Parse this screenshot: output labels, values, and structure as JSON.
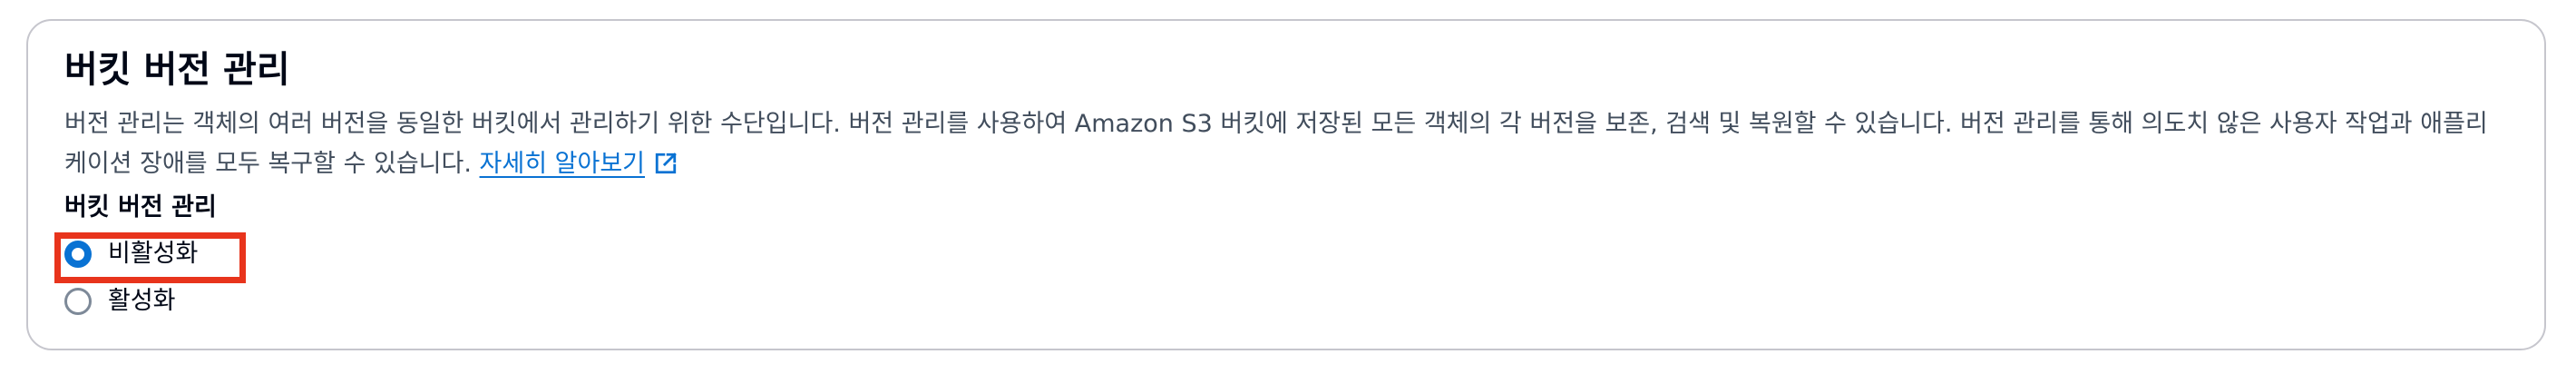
{
  "panel": {
    "title": "버킷 버전 관리",
    "description": "버전 관리는 객체의 여러 버전을 동일한 버킷에서 관리하기 위한 수단입니다. 버전 관리를 사용하여 Amazon S3 버킷에 저장된 모든 객체의 각 버전을 보존, 검색 및 복원할 수 있습니다. 버전 관리를 통해 의도치 않은 사용자 작업과 애플리케이션 장애를 모두 복구할 수 있습니다. ",
    "learn_more_label": "자세히 알아보기",
    "learn_more_icon": "external-link-icon"
  },
  "versioning": {
    "group_label": "버킷 버전 관리",
    "selected": "disable",
    "options": [
      {
        "id": "disable",
        "label": "비활성화"
      },
      {
        "id": "enable",
        "label": "활성화"
      }
    ]
  },
  "colors": {
    "link": "#0972d3",
    "radio_selected": "#0972d3",
    "radio_unselected": "#7d8998",
    "highlight_border": "#e8341c",
    "panel_border": "#c6c6cd"
  }
}
